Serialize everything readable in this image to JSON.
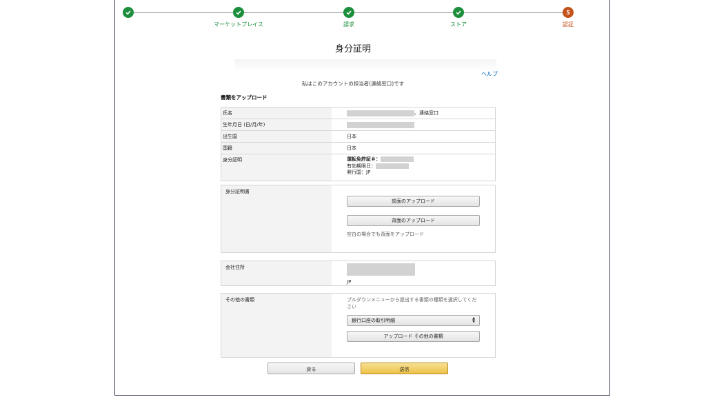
{
  "stepper": {
    "steps": [
      {
        "label": "",
        "state": "done"
      },
      {
        "label": "マーケットプレイス",
        "state": "done"
      },
      {
        "label": "請求",
        "state": "done"
      },
      {
        "label": "ストア",
        "state": "done"
      },
      {
        "label": "認証",
        "state": "current",
        "number": "5"
      }
    ],
    "colors": {
      "done": "#1c8e3c",
      "current": "#c4521b"
    }
  },
  "page": {
    "title": "身分証明",
    "help_link": "ヘルプ",
    "subtitle": "私はこのアカウントの担当者(連絡窓口)です",
    "section_heading": "書類をアップロード"
  },
  "info": {
    "rows": [
      {
        "label": "氏名",
        "value": "、連絡窓口"
      },
      {
        "label": "生年月日 (日/月/年)",
        "value": ""
      },
      {
        "label": "出生国",
        "value": "日本"
      },
      {
        "label": "国籍",
        "value": "日本"
      }
    ],
    "id_row": {
      "label": "身分証明",
      "license_label": "運転免許証＃：",
      "expiry_label": "有効期限日：",
      "issuer": "発行国：JP"
    }
  },
  "id_docs": {
    "label": "身分証明書",
    "front_button": "前面のアップロード",
    "back_button": "背面のアップロード",
    "note": "空白の場合でも背面をアップロード"
  },
  "address": {
    "label": "会社住所",
    "country": "JP"
  },
  "other_docs": {
    "label": "その他の書類",
    "instruction": "プルダウンメニューから提出する書類の種類を選択してください",
    "select_value": "銀行口座の取引明細",
    "upload_button": "アップロード その他の書類"
  },
  "actions": {
    "back": "戻る",
    "submit": "送信"
  }
}
